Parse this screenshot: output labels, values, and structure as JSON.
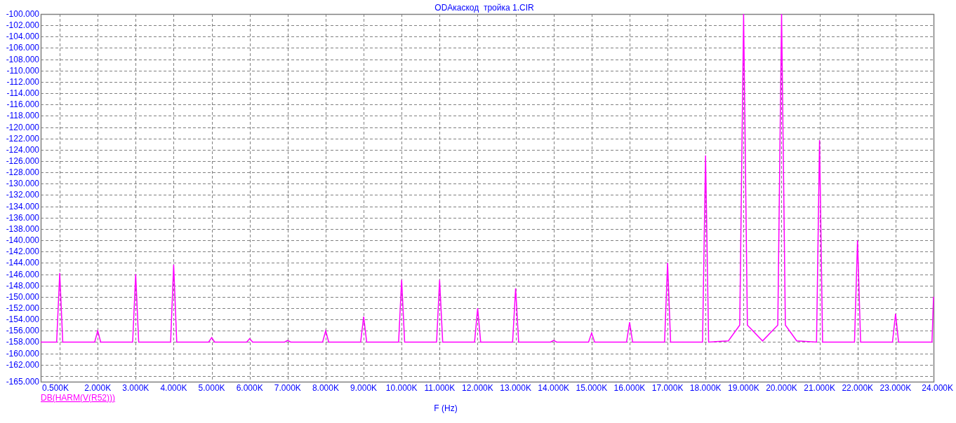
{
  "chart_data": {
    "type": "line",
    "grid": true,
    "title": "ODAкаскод  тройка 1.CIR",
    "xlabel": "F (Hz)",
    "xlim": [
      0.5,
      24
    ],
    "ylim": [
      -165,
      -100
    ],
    "xticks": [
      {
        "value": 0.5,
        "label": "0.500K"
      },
      {
        "value": 2,
        "label": "2.000K"
      },
      {
        "value": 3,
        "label": "3.000K"
      },
      {
        "value": 4,
        "label": "4.000K"
      },
      {
        "value": 5,
        "label": "5.000K"
      },
      {
        "value": 6,
        "label": "6.000K"
      },
      {
        "value": 7,
        "label": "7.000K"
      },
      {
        "value": 8,
        "label": "8.000K"
      },
      {
        "value": 9,
        "label": "9.000K"
      },
      {
        "value": 10,
        "label": "10.000K"
      },
      {
        "value": 11,
        "label": "11.000K"
      },
      {
        "value": 12,
        "label": "12.000K"
      },
      {
        "value": 13,
        "label": "13.000K"
      },
      {
        "value": 14,
        "label": "14.000K"
      },
      {
        "value": 15,
        "label": "15.000K"
      },
      {
        "value": 16,
        "label": "16.000K"
      },
      {
        "value": 17,
        "label": "17.000K"
      },
      {
        "value": 18,
        "label": "18.000K"
      },
      {
        "value": 19,
        "label": "19.000K"
      },
      {
        "value": 20,
        "label": "20.000K"
      },
      {
        "value": 21,
        "label": "21.000K"
      },
      {
        "value": 22,
        "label": "22.000K"
      },
      {
        "value": 23,
        "label": "23.000K"
      },
      {
        "value": 24,
        "label": "24.000K"
      }
    ],
    "yticks": [
      {
        "value": -100,
        "label": "-100.000"
      },
      {
        "value": -102,
        "label": "-102.000"
      },
      {
        "value": -104,
        "label": "-104.000"
      },
      {
        "value": -106,
        "label": "-106.000"
      },
      {
        "value": -108,
        "label": "-108.000"
      },
      {
        "value": -110,
        "label": "-110.000"
      },
      {
        "value": -112,
        "label": "-112.000"
      },
      {
        "value": -114,
        "label": "-114.000"
      },
      {
        "value": -116,
        "label": "-116.000"
      },
      {
        "value": -118,
        "label": "-118.000"
      },
      {
        "value": -120,
        "label": "-120.000"
      },
      {
        "value": -122,
        "label": "-122.000"
      },
      {
        "value": -124,
        "label": "-124.000"
      },
      {
        "value": -126,
        "label": "-126.000"
      },
      {
        "value": -128,
        "label": "-128.000"
      },
      {
        "value": -130,
        "label": "-130.000"
      },
      {
        "value": -132,
        "label": "-132.000"
      },
      {
        "value": -134,
        "label": "-134.000"
      },
      {
        "value": -136,
        "label": "-136.000"
      },
      {
        "value": -138,
        "label": "-138.000"
      },
      {
        "value": -140,
        "label": "-140.000"
      },
      {
        "value": -142,
        "label": "-142.000"
      },
      {
        "value": -144,
        "label": "-144.000"
      },
      {
        "value": -146,
        "label": "-146.000"
      },
      {
        "value": -148,
        "label": "-148.000"
      },
      {
        "value": -150,
        "label": "-150.000"
      },
      {
        "value": -152,
        "label": "-152.000"
      },
      {
        "value": -154,
        "label": "-154.000"
      },
      {
        "value": -156,
        "label": "-156.000"
      },
      {
        "value": -158,
        "label": "-158.000"
      },
      {
        "value": -160,
        "label": "-160.000"
      },
      {
        "value": -162,
        "label": "-162.000"
      },
      {
        "value": -165,
        "label": "-165.000"
      }
    ],
    "x": [
      0.5,
      0.92,
      1,
      1.08,
      1.92,
      2,
      2.08,
      2.92,
      3,
      3.08,
      3.92,
      4,
      4.08,
      4.92,
      5,
      5.08,
      5.92,
      6,
      6.08,
      6.92,
      7,
      7.08,
      7.92,
      8,
      8.08,
      8.92,
      9,
      9.08,
      9.92,
      10,
      10.08,
      10.92,
      11,
      11.08,
      11.92,
      12,
      12.08,
      12.92,
      13,
      13.08,
      13.92,
      14,
      14.08,
      14.92,
      15,
      15.08,
      15.92,
      16,
      16.08,
      16.92,
      17,
      17.08,
      17.92,
      18,
      18.08,
      18.6,
      18.9,
      19,
      19.1,
      19.5,
      19.9,
      20,
      20.1,
      20.4,
      20.92,
      21,
      21.08,
      21.92,
      22,
      22.08,
      22.92,
      23,
      23.08,
      23.96,
      24
    ],
    "series": [
      {
        "name": "DB(HARM(V(R52)))",
        "color": "#ff00ff",
        "values": [
          -158,
          -158,
          -145.8,
          -158,
          -158,
          -156,
          -158,
          -158,
          -146,
          -158,
          -158,
          -144.3,
          -158,
          -158,
          -157.2,
          -158,
          -158,
          -157.4,
          -158,
          -158,
          -157.7,
          -158,
          -158,
          -156,
          -158,
          -158,
          -153.5,
          -158,
          -158,
          -147,
          -158,
          -158,
          -147,
          -158,
          -158,
          -152,
          -158,
          -158,
          -148.5,
          -158,
          -158,
          -157.7,
          -158,
          -158,
          -156.4,
          -158,
          -158,
          -154.5,
          -158,
          -158,
          -144,
          -158,
          -158,
          -125,
          -158,
          -157.8,
          -155,
          -100,
          -155,
          -157.8,
          -155,
          -100,
          -155,
          -157.8,
          -158,
          -122.3,
          -158,
          -158,
          -140,
          -158,
          -158,
          -153,
          -158,
          -158,
          -150
        ]
      }
    ]
  }
}
